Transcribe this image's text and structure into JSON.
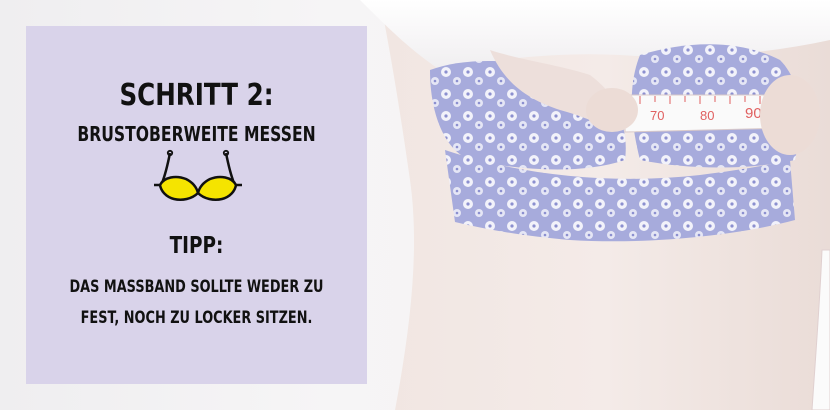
{
  "panel": {
    "title": "SCHRITT 2:",
    "subtitle": "BRUSTOBERWEITE MESSEN",
    "tip_label": "TIPP:",
    "tip_text": "DAS MASSBAND SOLLTE WEDER ZU\nFEST, NOCH ZU LOCKER SITZEN."
  },
  "photo": {
    "tape_marks": [
      "70",
      "80",
      "90"
    ]
  },
  "colors": {
    "panel_background": "#d9d3ea",
    "bra_icon_yellow": "#f5e400",
    "lace_lavender": "#9a9fd6"
  }
}
